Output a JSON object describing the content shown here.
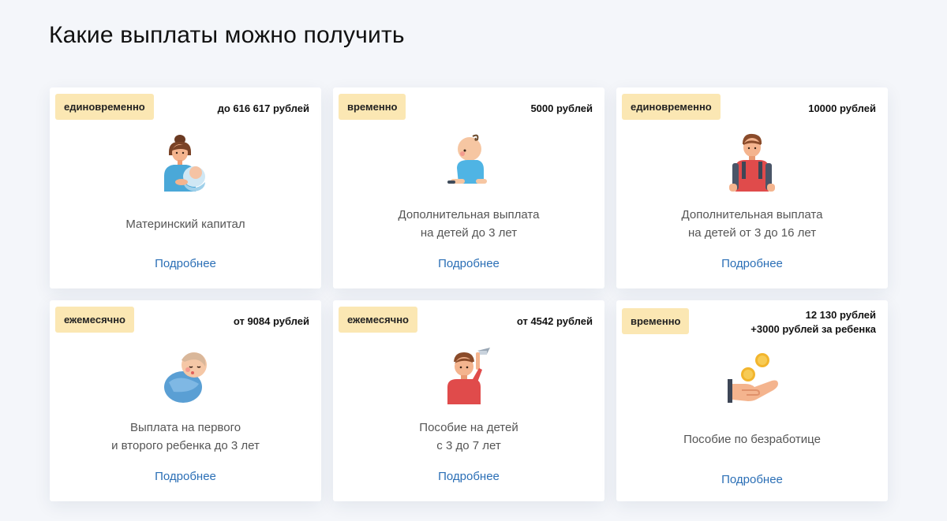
{
  "page": {
    "title": "Какие выплаты можно получить"
  },
  "cards": [
    {
      "badge": "единовременно",
      "amount": [
        "до 616 617 рублей"
      ],
      "title": [
        "Материнский капитал"
      ],
      "icon": "mother-with-baby-icon",
      "link": "Подробнее"
    },
    {
      "badge": "временно",
      "amount": [
        "5000 рублей"
      ],
      "title": [
        "Дополнительная выплата",
        "на детей до 3 лет"
      ],
      "icon": "crawling-baby-icon",
      "link": "Подробнее"
    },
    {
      "badge": "единовременно",
      "amount": [
        "10000 рублей"
      ],
      "title": [
        "Дополнительная выплата",
        "на детей от 3 до 16 лет"
      ],
      "icon": "schoolboy-with-backpack-icon",
      "link": "Подробнее"
    },
    {
      "badge": "ежемесячно",
      "amount": [
        "от 9084 рублей"
      ],
      "title": [
        "Выплата на первого",
        "и второго ребенка до 3 лет"
      ],
      "icon": "swaddled-baby-icon",
      "link": "Подробнее"
    },
    {
      "badge": "ежемесячно",
      "amount": [
        "от 4542 рублей"
      ],
      "title": [
        "Пособие на детей",
        "с 3 до 7 лет"
      ],
      "icon": "child-with-toy-plane-icon",
      "link": "Подробнее"
    },
    {
      "badge": "временно",
      "amount": [
        "12 130 рублей",
        "+3000 рублей за ребенка"
      ],
      "title": [
        "Пособие по безработице"
      ],
      "icon": "hand-with-coins-icon",
      "link": "Подробнее"
    }
  ],
  "colors": {
    "background": "#f4f6fa",
    "badge": "#fbe7b3",
    "link": "#2b6fb6",
    "card": "#ffffff"
  }
}
